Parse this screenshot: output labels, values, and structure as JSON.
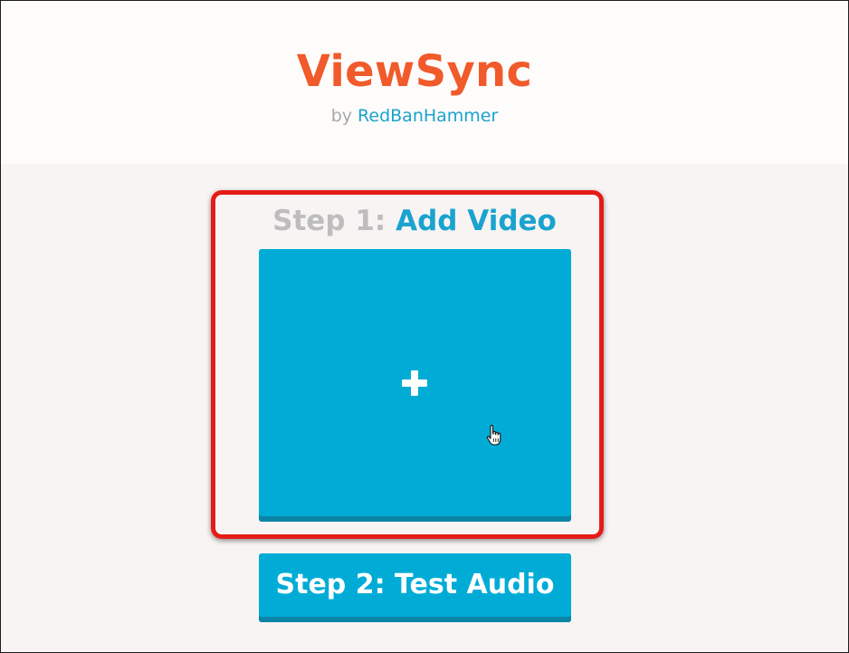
{
  "header": {
    "title": "ViewSync",
    "byline_prefix": "by",
    "author": "RedBanHammer"
  },
  "step1": {
    "prefix": "Step 1:",
    "action": "Add Video",
    "button_icon": "plus-icon"
  },
  "step2": {
    "label": "Step 2: Test Audio"
  },
  "colors": {
    "brand_orange": "#f15a2a",
    "accent_blue": "#00acd6",
    "link_blue": "#1aa3cf",
    "highlight_red": "#e41b17"
  }
}
